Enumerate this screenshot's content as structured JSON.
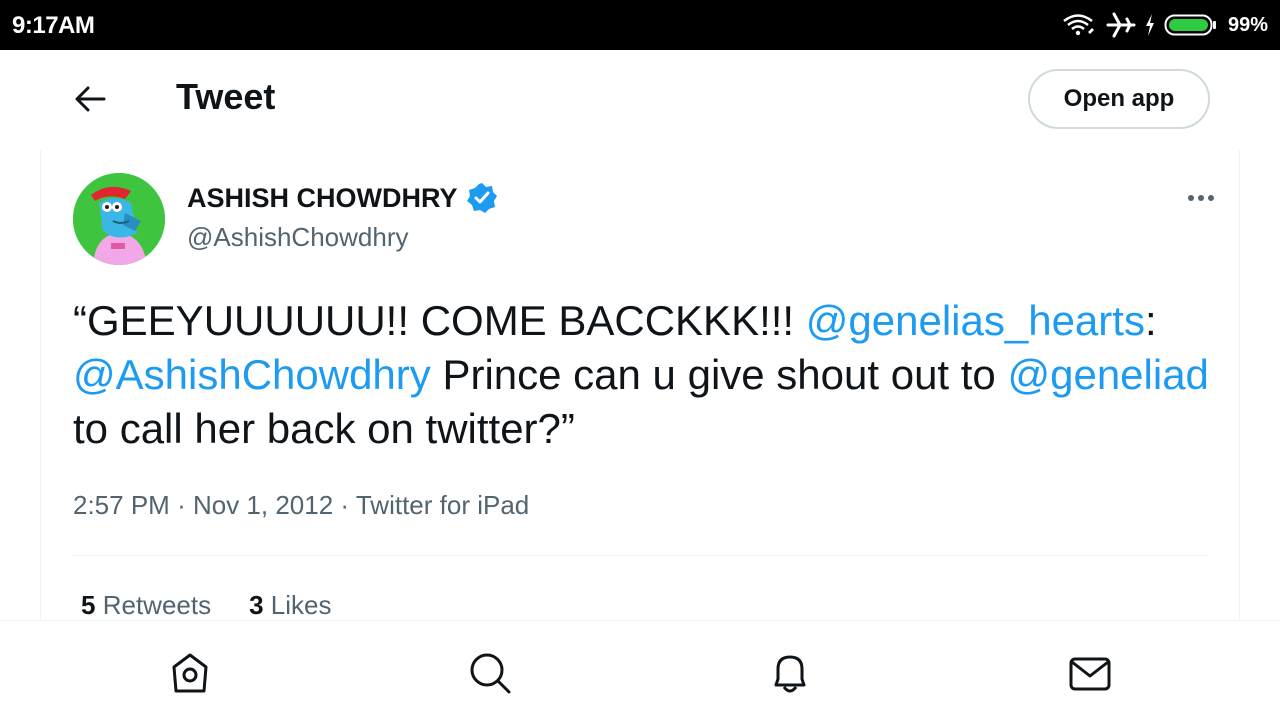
{
  "status_bar": {
    "time": "9:17AM",
    "battery_percent": "99%",
    "icons": [
      "wifi-icon",
      "airplane-icon",
      "charging-icon",
      "battery-icon"
    ]
  },
  "header": {
    "title": "Tweet",
    "open_app_label": "Open app",
    "back_icon": "arrow-left-icon"
  },
  "tweet": {
    "display_name": "ASHISH CHOWDHRY",
    "handle": "@AshishChowdhry",
    "verified": true,
    "text_parts": {
      "p1": "“GEEYUUUUUU!! COME BACCKKK!!! ",
      "m1": "@genelias_hearts",
      "p2": ": ",
      "m2": "@AshishChowdhry",
      "p3": " Prince can u give shout out to ",
      "m3": "@geneliad",
      "p4": " to call her back on twitter?”"
    },
    "time": "2:57 PM",
    "date": "Nov 1, 2012",
    "source": "Twitter for iPad",
    "separator": "·",
    "retweets_count": "5",
    "retweets_label": "Retweets",
    "likes_count": "3",
    "likes_label": "Likes"
  },
  "bottom_nav": {
    "items": [
      "home-icon",
      "search-icon",
      "notifications-icon",
      "messages-icon"
    ]
  },
  "colors": {
    "link": "#1d9bf0",
    "secondary_text": "#536471",
    "primary_text": "#0f1419",
    "verified_badge": "#1d9bf0"
  }
}
